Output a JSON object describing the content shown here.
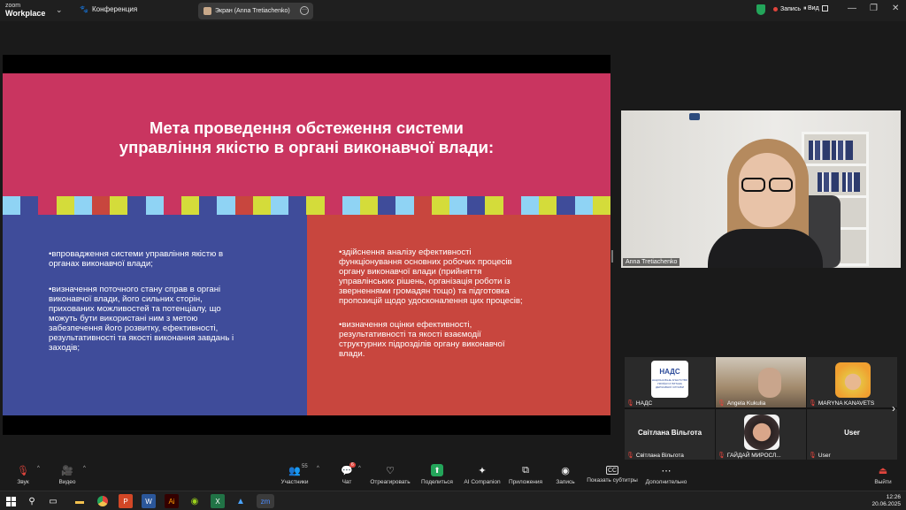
{
  "app": {
    "logo_line1": "zoom",
    "logo_line2": "Workplace",
    "meeting_label": "Конференция"
  },
  "share_tab": {
    "label": "Экран (Anna Tretiachenko)"
  },
  "top_right": {
    "record_label": "Запись",
    "view_label": "Вид"
  },
  "slide": {
    "title_line1": "Мета проведення обстеження системи",
    "title_line2": "управління якістю в органі виконавчої влади:",
    "stripe_colors": [
      "#8fd3f4",
      "#3f4c9a",
      "#c93560",
      "#d4dc3a",
      "#8fd3f4",
      "#c8463e",
      "#d4dc3a",
      "#3f4c9a",
      "#8fd3f4",
      "#c93560",
      "#d4dc3a",
      "#3f4c9a",
      "#8fd3f4",
      "#c8463e",
      "#d4dc3a",
      "#8fd3f4",
      "#3f4c9a",
      "#d4dc3a",
      "#c93560",
      "#8fd3f4",
      "#d4dc3a",
      "#3f4c9a",
      "#8fd3f4",
      "#c8463e",
      "#d4dc3a",
      "#8fd3f4",
      "#3f4c9a",
      "#d4dc3a",
      "#c93560",
      "#8fd3f4",
      "#d4dc3a",
      "#3f4c9a",
      "#8fd3f4",
      "#d4dc3a"
    ],
    "left_bullets": [
      [
        "•впровадження системи управління якістю в",
        "органах виконавчої влади;"
      ],
      [
        "•визначення поточного стану справ в органі",
        "виконавчої влади, його сильних сторін,",
        "прихованих можливостей та потенціалу, що",
        "можуть бути використані ним з метою",
        "забезпечення його розвитку, ефективності,",
        "результативності та якості виконання завдань і",
        "заходів;"
      ]
    ],
    "right_bullets": [
      [
        "•здійснення аналізу ефективності",
        "функціонування основних робочих процесів",
        "органу виконавчої влади (прийняття",
        "управлінських рішень, організація роботи із",
        "зверненнями громадян тощо) та підготовка",
        "пропозицій щодо удосконалення цих процесів;"
      ],
      [
        "•визначення оцінки ефективності,",
        "результативності та якості взаємодії",
        "структурних підрозділів органу виконавчої",
        "влади."
      ]
    ]
  },
  "speaker": {
    "name": "Anna Tretiachenko"
  },
  "gallery": {
    "tiles": [
      {
        "name": "НАДС",
        "logo_text": "НАДС",
        "logo_sub": "НАЦІОНАЛЬНЕ АГЕНТСТВО УКРАЇНИ З ПИТАНЬ ДЕРЖАВНОЇ СЛУЖБИ"
      },
      {
        "name": "Angela Kukulia"
      },
      {
        "name": "MARYNA KANAVETS"
      },
      {
        "name": "Світлана Вільгота",
        "big": "Світлана Вільгота"
      },
      {
        "name": "ГАЙДАЙ МИРОСЛ..."
      },
      {
        "name": "User",
        "big": "User"
      }
    ]
  },
  "toolbar": {
    "audio": "Звук",
    "video": "Видео",
    "participants": "Участники",
    "participants_count": "55",
    "chat": "Чат",
    "chat_badge": "6",
    "react": "Отреагировать",
    "share": "Поделиться",
    "ai": "AI Companion",
    "apps": "Приложения",
    "record": "Запись",
    "captions": "Показать субтитры",
    "more": "Дополнительно",
    "leave": "Выйти"
  },
  "taskbar": {
    "time": "12:26",
    "date": "20.06.2025"
  },
  "colors": {
    "slide_top": "#c93560",
    "left_panel": "#3f4c9a",
    "right_panel": "#c8463e",
    "record_dot": "#e0443c",
    "shield": "#23a55a"
  }
}
